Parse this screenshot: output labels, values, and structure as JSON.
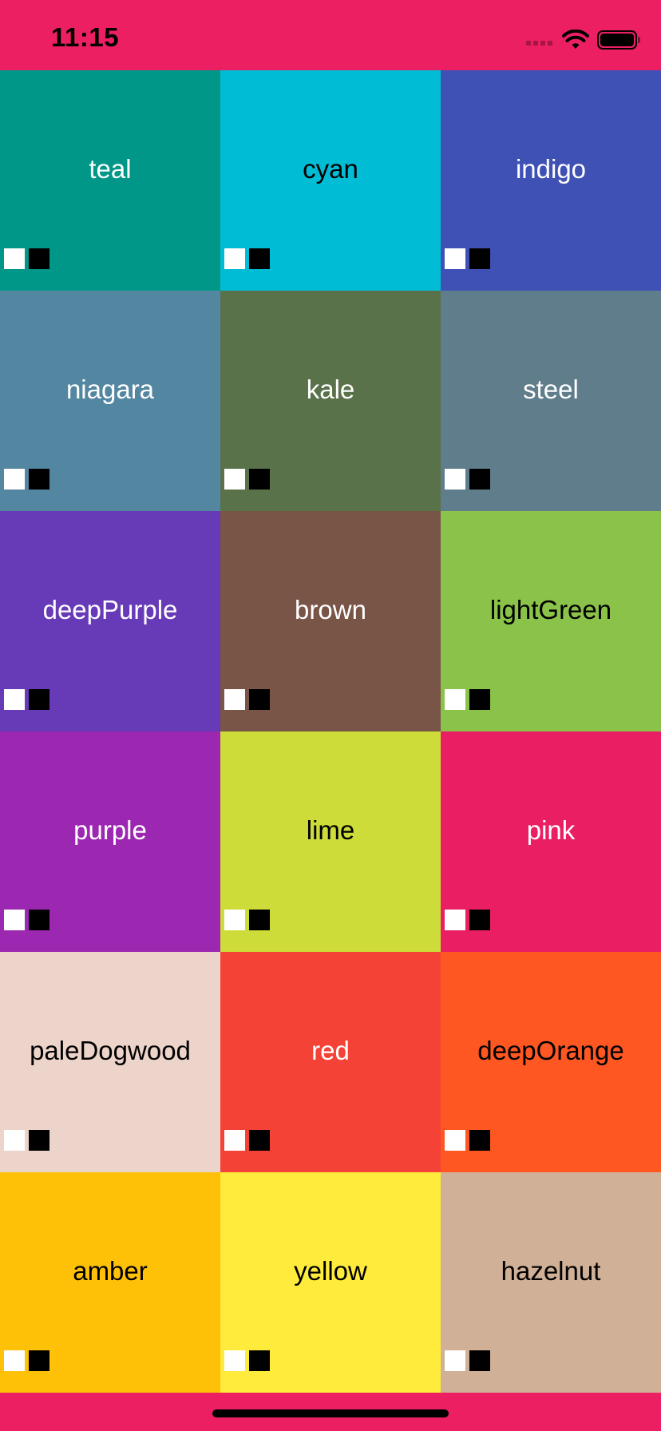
{
  "status_bar": {
    "time": "11:15",
    "icons": [
      "cellular-signal-icon",
      "wifi-icon",
      "battery-icon"
    ]
  },
  "theme": {
    "background": "#ED1F63",
    "swatch_colors": [
      "#FFFFFF",
      "#000000"
    ]
  },
  "colors": [
    {
      "name": "teal",
      "hex": "#009688",
      "text": "#FFFFFF"
    },
    {
      "name": "cyan",
      "hex": "#00BCD4",
      "text": "#000000"
    },
    {
      "name": "indigo",
      "hex": "#3F51B5",
      "text": "#FFFFFF"
    },
    {
      "name": "niagara",
      "hex": "#5386A1",
      "text": "#FFFFFF"
    },
    {
      "name": "kale",
      "hex": "#5A724A",
      "text": "#FFFFFF"
    },
    {
      "name": "steel",
      "hex": "#607D8B",
      "text": "#FFFFFF"
    },
    {
      "name": "deepPurple",
      "hex": "#673AB7",
      "text": "#FFFFFF"
    },
    {
      "name": "brown",
      "hex": "#795548",
      "text": "#FFFFFF"
    },
    {
      "name": "lightGreen",
      "hex": "#8BC34A",
      "text": "#000000"
    },
    {
      "name": "purple",
      "hex": "#9C27B0",
      "text": "#FFFFFF"
    },
    {
      "name": "lime",
      "hex": "#CDDC39",
      "text": "#000000"
    },
    {
      "name": "pink",
      "hex": "#E91E63",
      "text": "#FFFFFF"
    },
    {
      "name": "paleDogwood",
      "hex": "#EDD4CA",
      "text": "#000000"
    },
    {
      "name": "red",
      "hex": "#F44336",
      "text": "#FFFFFF"
    },
    {
      "name": "deepOrange",
      "hex": "#FF5722",
      "text": "#000000"
    },
    {
      "name": "amber",
      "hex": "#FFC107",
      "text": "#000000"
    },
    {
      "name": "yellow",
      "hex": "#FFEB3B",
      "text": "#000000"
    },
    {
      "name": "hazelnut",
      "hex": "#D0B096",
      "text": "#000000"
    }
  ]
}
